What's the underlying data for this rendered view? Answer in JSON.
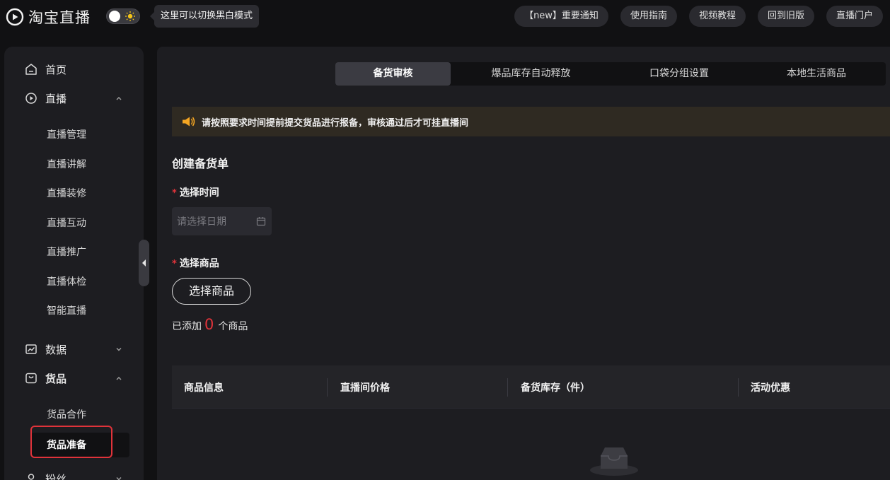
{
  "app": {
    "logo_text": "淘宝直播",
    "theme_tooltip": "这里可以切换黑白模式"
  },
  "topnav": [
    {
      "label": "【new】重要通知"
    },
    {
      "label": "使用指南"
    },
    {
      "label": "视频教程"
    },
    {
      "label": "回到旧版"
    },
    {
      "label": "直播门户"
    }
  ],
  "sidebar": {
    "home": "首页",
    "live": "直播",
    "live_items": [
      "直播管理",
      "直播讲解",
      "直播装修",
      "直播互动",
      "直播推广",
      "直播体检",
      "智能直播"
    ],
    "data": "数据",
    "goods": "货品",
    "goods_items": [
      "货品合作",
      "货品准备"
    ],
    "fans": "粉丝"
  },
  "tabs": [
    {
      "label": "备货审核",
      "active": true
    },
    {
      "label": "爆品库存自动释放",
      "active": false
    },
    {
      "label": "口袋分组设置",
      "active": false
    },
    {
      "label": "本地生活商品",
      "active": false
    }
  ],
  "notice": {
    "text": "请按照要求时间提前提交货品进行报备，审核通过后才可挂直播间"
  },
  "form": {
    "title": "创建备货单",
    "time_label": "选择时间",
    "required_mark": "*",
    "date_placeholder": "请选择日期",
    "goods_label": "选择商品",
    "choose_button": "选择商品",
    "added_prefix": "已添加",
    "added_count": "0",
    "added_suffix": "个商品"
  },
  "table": {
    "columns": [
      "商品信息",
      "直播间价格",
      "备货库存（件）",
      "活动优惠"
    ]
  },
  "colors": {
    "accent_red": "#e0333a",
    "notice_icon": "#f5a623",
    "background": "#111113",
    "panel": "#1d1d21"
  }
}
